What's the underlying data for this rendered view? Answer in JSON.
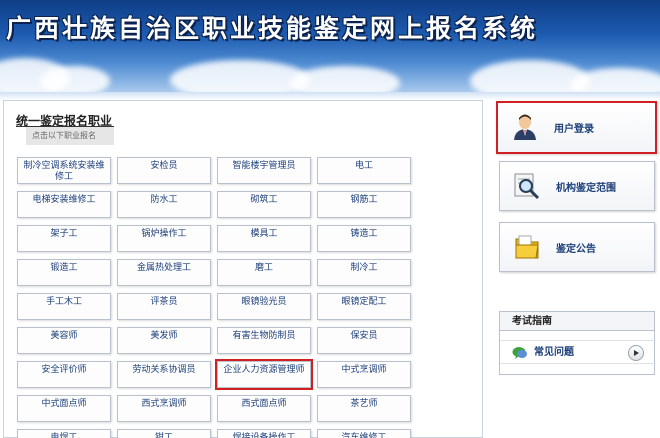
{
  "header": {
    "title": "广西壮族自治区职业技能鉴定网上报名系统"
  },
  "left_panel": {
    "title": "统一鉴定报名职业",
    "hint": "点击以下职业报名",
    "jobs": [
      "制冷空调系统安装维修工",
      "安检员",
      "智能楼宇管理员",
      "电工",
      "电梯安装维修工",
      "防水工",
      "砌筑工",
      "钢筋工",
      "架子工",
      "锅炉操作工",
      "模具工",
      "铸造工",
      "锻造工",
      "金属热处理工",
      "磨工",
      "制冷工",
      "手工木工",
      "评茶员",
      "眼镜验光员",
      "眼镜定配工",
      "美容师",
      "美发师",
      "有害生物防制员",
      "保安员",
      "安全评价师",
      "劳动关系协调员",
      "企业人力资源管理师",
      "中式烹调师",
      "中式面点师",
      "西式烹调师",
      "西式面点师",
      "茶艺师",
      "电焊工",
      "钳工",
      "焊接设备操作工",
      "汽车维修工"
    ],
    "highlighted_job": "企业人力资源管理师"
  },
  "sidebar": {
    "login_label": "用户登录",
    "scope_label": "机构鉴定范围",
    "notice_label": "鉴定公告",
    "exam_guide_title": "考试指南",
    "faq_label": "常见问题"
  },
  "colors": {
    "highlight_border": "#d21f24",
    "link_text": "#1d3f7a",
    "banner_top": "#0f3e86",
    "banner_bottom": "#a9c9ec"
  },
  "icons": {
    "login": "user-icon",
    "scope": "magnifier-icon",
    "notice": "folder-icon",
    "faq": "chat-icon",
    "faq_arrow": "play-arrow-icon"
  }
}
